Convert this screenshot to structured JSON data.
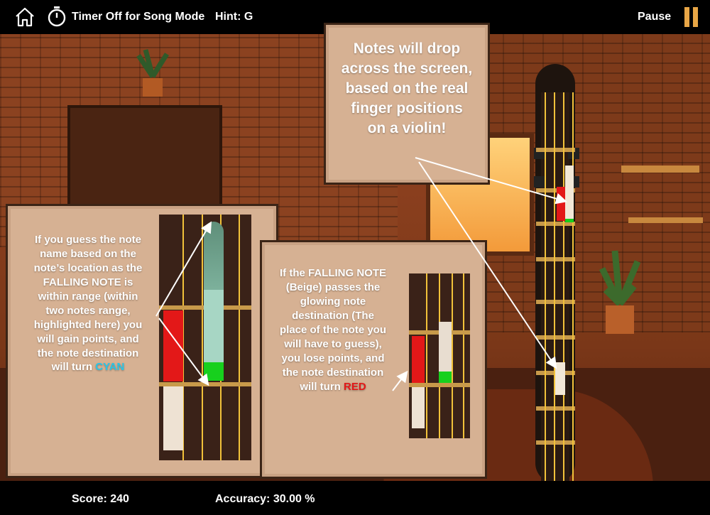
{
  "header": {
    "timer_label": "Timer Off for Song Mode",
    "hint_label": "Hint: G",
    "pause_label": "Pause"
  },
  "footer": {
    "score_label": "Score: 240",
    "accuracy_label": "Accuracy: 30.00 %"
  },
  "panels": {
    "top": {
      "lines": [
        "Notes will drop",
        "across the screen,",
        "based on the real",
        "finger positions",
        "on a violin!"
      ]
    },
    "left": {
      "lines": [
        "If you guess the note",
        "name based on the",
        "note’s location as the",
        "FALLING NOTE is",
        "within range  (within",
        "two notes range,",
        "highlighted here) you",
        "will gain points, and",
        "the note destination"
      ],
      "last_prefix": "will turn ",
      "last_word": "CYAN"
    },
    "middle": {
      "lines": [
        "If the FALLING NOTE",
        "(Beige)  passes the",
        "glowing note",
        "destination (The",
        "place of the note you",
        "will have to guess),",
        "you lose points, and",
        "the note destination"
      ],
      "last_prefix": "will turn ",
      "last_word": "RED"
    }
  },
  "colors": {
    "panel": "#d6b193",
    "cyan": "#29c4e6",
    "red": "#e31818",
    "falling_note": "#f2e8d8",
    "green": "#17d01d"
  }
}
